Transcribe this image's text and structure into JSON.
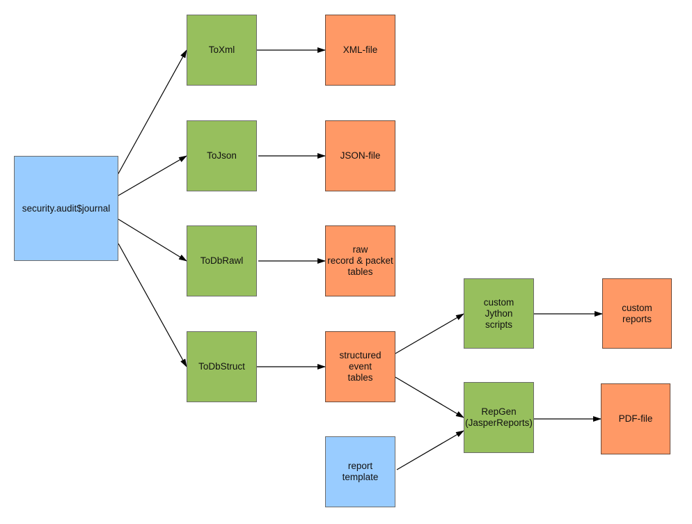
{
  "diagram": {
    "type": "flowchart",
    "colors": {
      "source": "#99ccff",
      "process": "#97bf5d",
      "output": "#ff9966",
      "edge": "#000000"
    },
    "nodes": [
      {
        "id": "journal",
        "label": "security.audit$journal",
        "kind": "source"
      },
      {
        "id": "toxml",
        "label": "ToXml",
        "kind": "process"
      },
      {
        "id": "tojson",
        "label": "ToJson",
        "kind": "process"
      },
      {
        "id": "todbrawl",
        "label": "ToDbRawl",
        "kind": "process"
      },
      {
        "id": "todbstruct",
        "label": "ToDbStruct",
        "kind": "process"
      },
      {
        "id": "xmlfile",
        "label": "XML-file",
        "kind": "output"
      },
      {
        "id": "jsonfile",
        "label": "JSON-file",
        "kind": "output"
      },
      {
        "id": "rawtables",
        "label": "raw\nrecord & packet\ntables",
        "kind": "output"
      },
      {
        "id": "structtables",
        "label": "structured\nevent\ntables",
        "kind": "output"
      },
      {
        "id": "reporttemplate",
        "label": "report\ntemplate",
        "kind": "source"
      },
      {
        "id": "jython",
        "label": "custom\nJython\nscripts",
        "kind": "process"
      },
      {
        "id": "repgen",
        "label": "RepGen\n(JasperReports)",
        "kind": "process"
      },
      {
        "id": "customreports",
        "label": "custom\nreports",
        "kind": "output"
      },
      {
        "id": "pdffile",
        "label": "PDF-file",
        "kind": "output"
      }
    ],
    "edges": [
      {
        "from": "journal",
        "to": "toxml"
      },
      {
        "from": "journal",
        "to": "tojson"
      },
      {
        "from": "journal",
        "to": "todbrawl"
      },
      {
        "from": "journal",
        "to": "todbstruct"
      },
      {
        "from": "toxml",
        "to": "xmlfile"
      },
      {
        "from": "tojson",
        "to": "jsonfile"
      },
      {
        "from": "todbrawl",
        "to": "rawtables"
      },
      {
        "from": "todbstruct",
        "to": "structtables"
      },
      {
        "from": "structtables",
        "to": "jython"
      },
      {
        "from": "structtables",
        "to": "repgen"
      },
      {
        "from": "reporttemplate",
        "to": "repgen"
      },
      {
        "from": "jython",
        "to": "customreports"
      },
      {
        "from": "repgen",
        "to": "pdffile"
      }
    ]
  }
}
